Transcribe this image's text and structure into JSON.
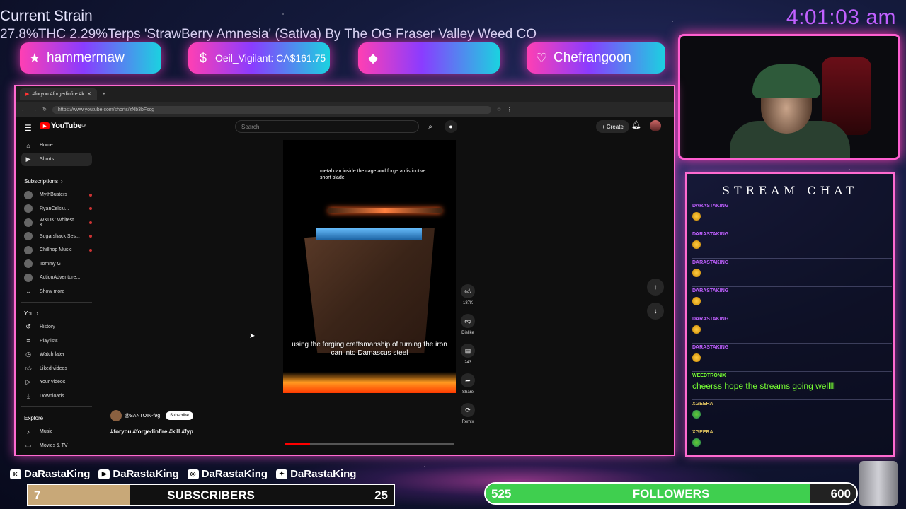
{
  "overlay": {
    "strain_title": "Current Strain",
    "strain_line": "27.8%THC 2.29%Terps 'StrawBerry Amnesia' (Sativa) By The OG Fraser Valley Weed CO",
    "clock": "4:01:03 am",
    "badges": [
      {
        "icon": "star-icon",
        "text": "hammermaw"
      },
      {
        "icon": "dollar-icon",
        "text": "Oeil_Vigilant: CA$161.75"
      },
      {
        "icon": "diamond-icon",
        "text": ""
      },
      {
        "icon": "heart-icon",
        "text": "Chefrangoon"
      }
    ],
    "accent_color": "#ff5fd0"
  },
  "browser": {
    "tab_title": "#foryou #forgedinfire #k",
    "url": "https://www.youtube.com/shorts/zNb3bFscg"
  },
  "youtube": {
    "logo": "YouTube",
    "region": "CA",
    "search_placeholder": "Search",
    "create_label": "Create",
    "sidebar": {
      "main": [
        {
          "icon": "home-icon",
          "label": "Home"
        },
        {
          "icon": "shorts-icon",
          "label": "Shorts"
        }
      ],
      "subscriptions_heading": "Subscriptions",
      "subscriptions": [
        "MythBusters",
        "RyanCelsiu...",
        "WKUK: Whitest K...",
        "Sugarshack Ses...",
        "Chillhop Music",
        "Tommy G",
        "ActionAdventure..."
      ],
      "show_more": "Show more",
      "you_heading": "You",
      "you_items": [
        {
          "icon": "history-icon",
          "label": "History"
        },
        {
          "icon": "playlists-icon",
          "label": "Playlists"
        },
        {
          "icon": "watch-later-icon",
          "label": "Watch later"
        },
        {
          "icon": "liked-icon",
          "label": "Liked videos"
        },
        {
          "icon": "your-videos-icon",
          "label": "Your videos"
        },
        {
          "icon": "downloads-icon",
          "label": "Downloads"
        }
      ],
      "explore_heading": "Explore",
      "explore_items": [
        {
          "icon": "music-icon",
          "label": "Music"
        },
        {
          "icon": "tv-icon",
          "label": "Movies & TV"
        }
      ]
    },
    "short": {
      "top_caption": "metal can inside the cage and forge a distinctive short blade",
      "subtitle": "using the forging craftsmanship of turning the iron can into Damascus steel",
      "channel": "@SANTOIN-f9g",
      "subscribe_label": "Subscribe",
      "hashtags": "#foryou #forgedinfire #kill #fyp",
      "progress": 0.15
    },
    "actions": {
      "like_count": "187K",
      "dislike_label": "Dislike",
      "comment_count": "243",
      "share_label": "Share",
      "remix_label": "Remix"
    }
  },
  "chat": {
    "title": "STREAM CHAT",
    "messages": [
      {
        "user": "DARASTAKING",
        "text": "",
        "emote": "face-emote"
      },
      {
        "user": "DARASTAKING",
        "text": "",
        "emote": "face-emote"
      },
      {
        "user": "DARASTAKING",
        "text": "",
        "emote": "face-emote"
      },
      {
        "user": "DARASTAKING",
        "text": "",
        "emote": "face-emote"
      },
      {
        "user": "DARASTAKING",
        "text": "",
        "emote": "face-emote"
      },
      {
        "user": "DARASTAKING",
        "text": "",
        "emote": "face-emote"
      },
      {
        "user": "WEEDTRONIX",
        "text": "cheerss hope the streams going welllll",
        "emote": ""
      },
      {
        "user": "XGEERA",
        "text": "",
        "emote": "pepe-emote"
      },
      {
        "user": "XGEERA",
        "text": "",
        "emote": "pepe-emote"
      }
    ]
  },
  "socials": [
    {
      "icon": "kick-icon",
      "handle": "DaRastaKing"
    },
    {
      "icon": "youtube-icon",
      "handle": "DaRastaKing"
    },
    {
      "icon": "instagram-icon",
      "handle": "DaRastaKing"
    },
    {
      "icon": "twitter-icon",
      "handle": "DaRastaKing"
    }
  ],
  "goals": {
    "subscribers": {
      "current": "7",
      "label": "SUBSCRIBERS",
      "target": "25",
      "fraction": 0.28
    },
    "followers": {
      "current": "525",
      "label": "FOLLOWERS",
      "target": "600",
      "fraction": 0.875
    }
  }
}
